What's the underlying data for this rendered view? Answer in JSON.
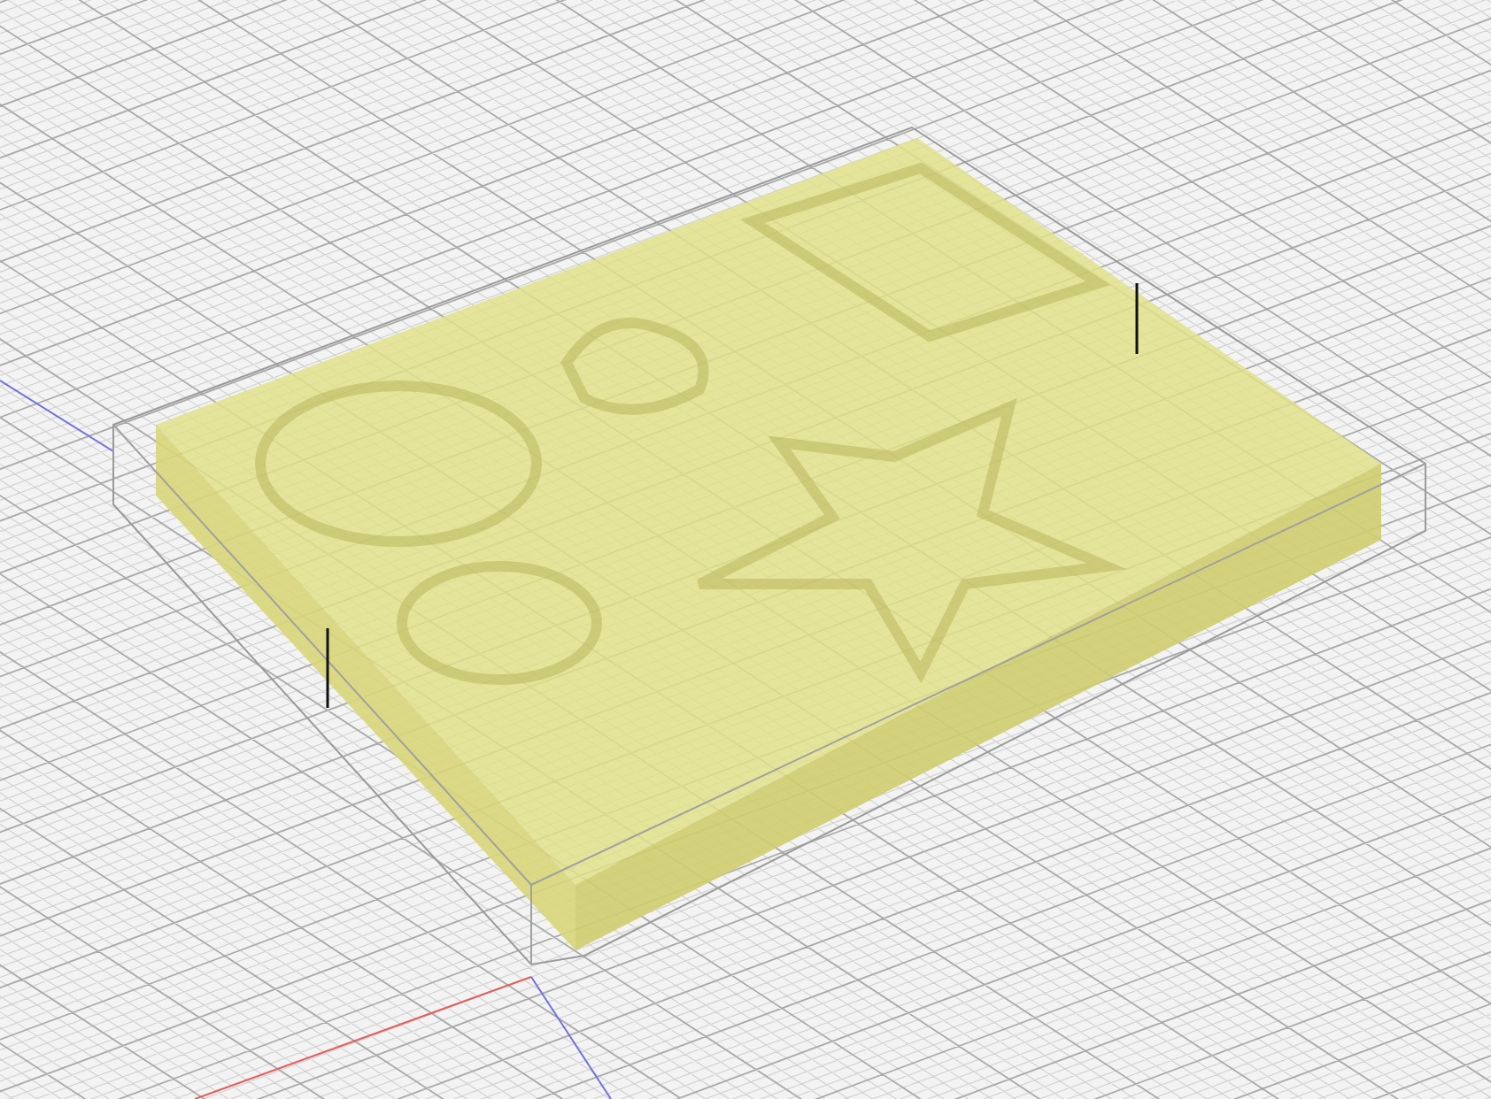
{
  "viewport": {
    "kind": "perspective-3d"
  }
}
